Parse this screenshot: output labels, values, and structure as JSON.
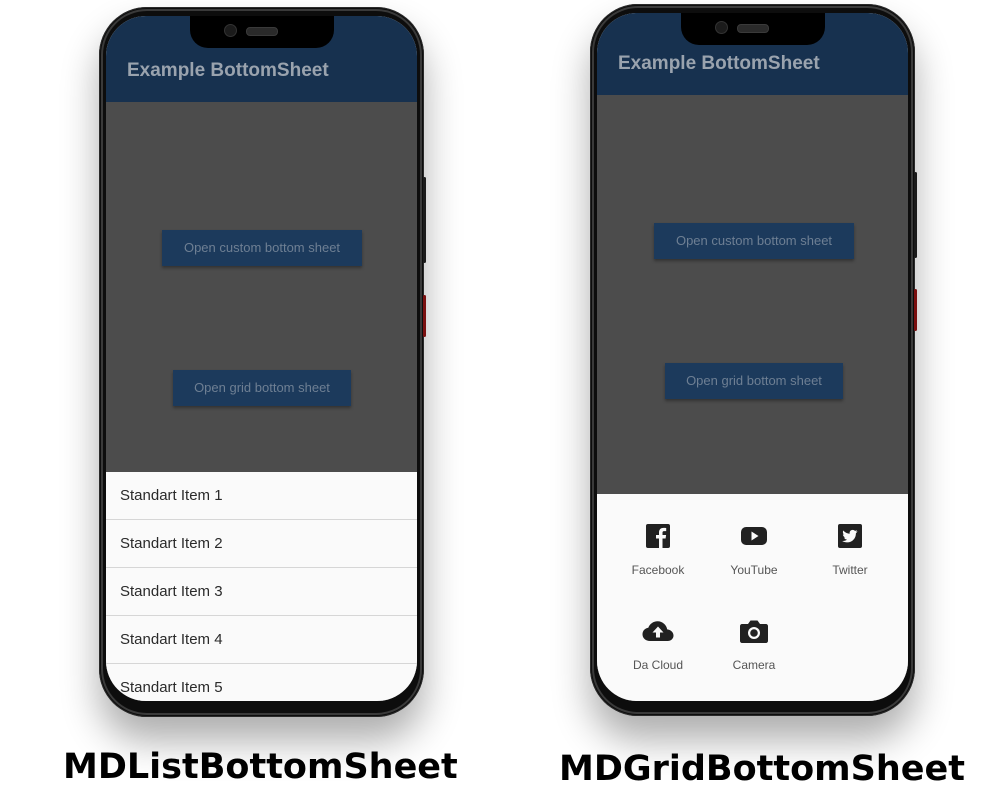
{
  "colors": {
    "appbar": "#17314f",
    "scrim": "#4c4c4c",
    "button": "#1c3a5c",
    "sheet": "#fafafa"
  },
  "left_phone": {
    "appbar_title": "Example BottomSheet",
    "buttons": {
      "custom": "Open custom bottom sheet",
      "grid": "Open grid bottom sheet"
    },
    "list_items": [
      "Standart Item 1",
      "Standart Item 2",
      "Standart Item 3",
      "Standart Item 4",
      "Standart Item 5"
    ],
    "caption": "MDListBottomSheet"
  },
  "right_phone": {
    "appbar_title": "Example BottomSheet",
    "buttons": {
      "custom": "Open custom bottom sheet",
      "grid": "Open grid bottom sheet"
    },
    "grid_items": [
      {
        "label": "Facebook",
        "icon": "facebook-icon"
      },
      {
        "label": "YouTube",
        "icon": "youtube-icon"
      },
      {
        "label": "Twitter",
        "icon": "twitter-icon"
      },
      {
        "label": "Da Cloud",
        "icon": "cloud-upload-icon"
      },
      {
        "label": "Camera",
        "icon": "camera-icon"
      }
    ],
    "caption": "MDGridBottomSheet"
  }
}
